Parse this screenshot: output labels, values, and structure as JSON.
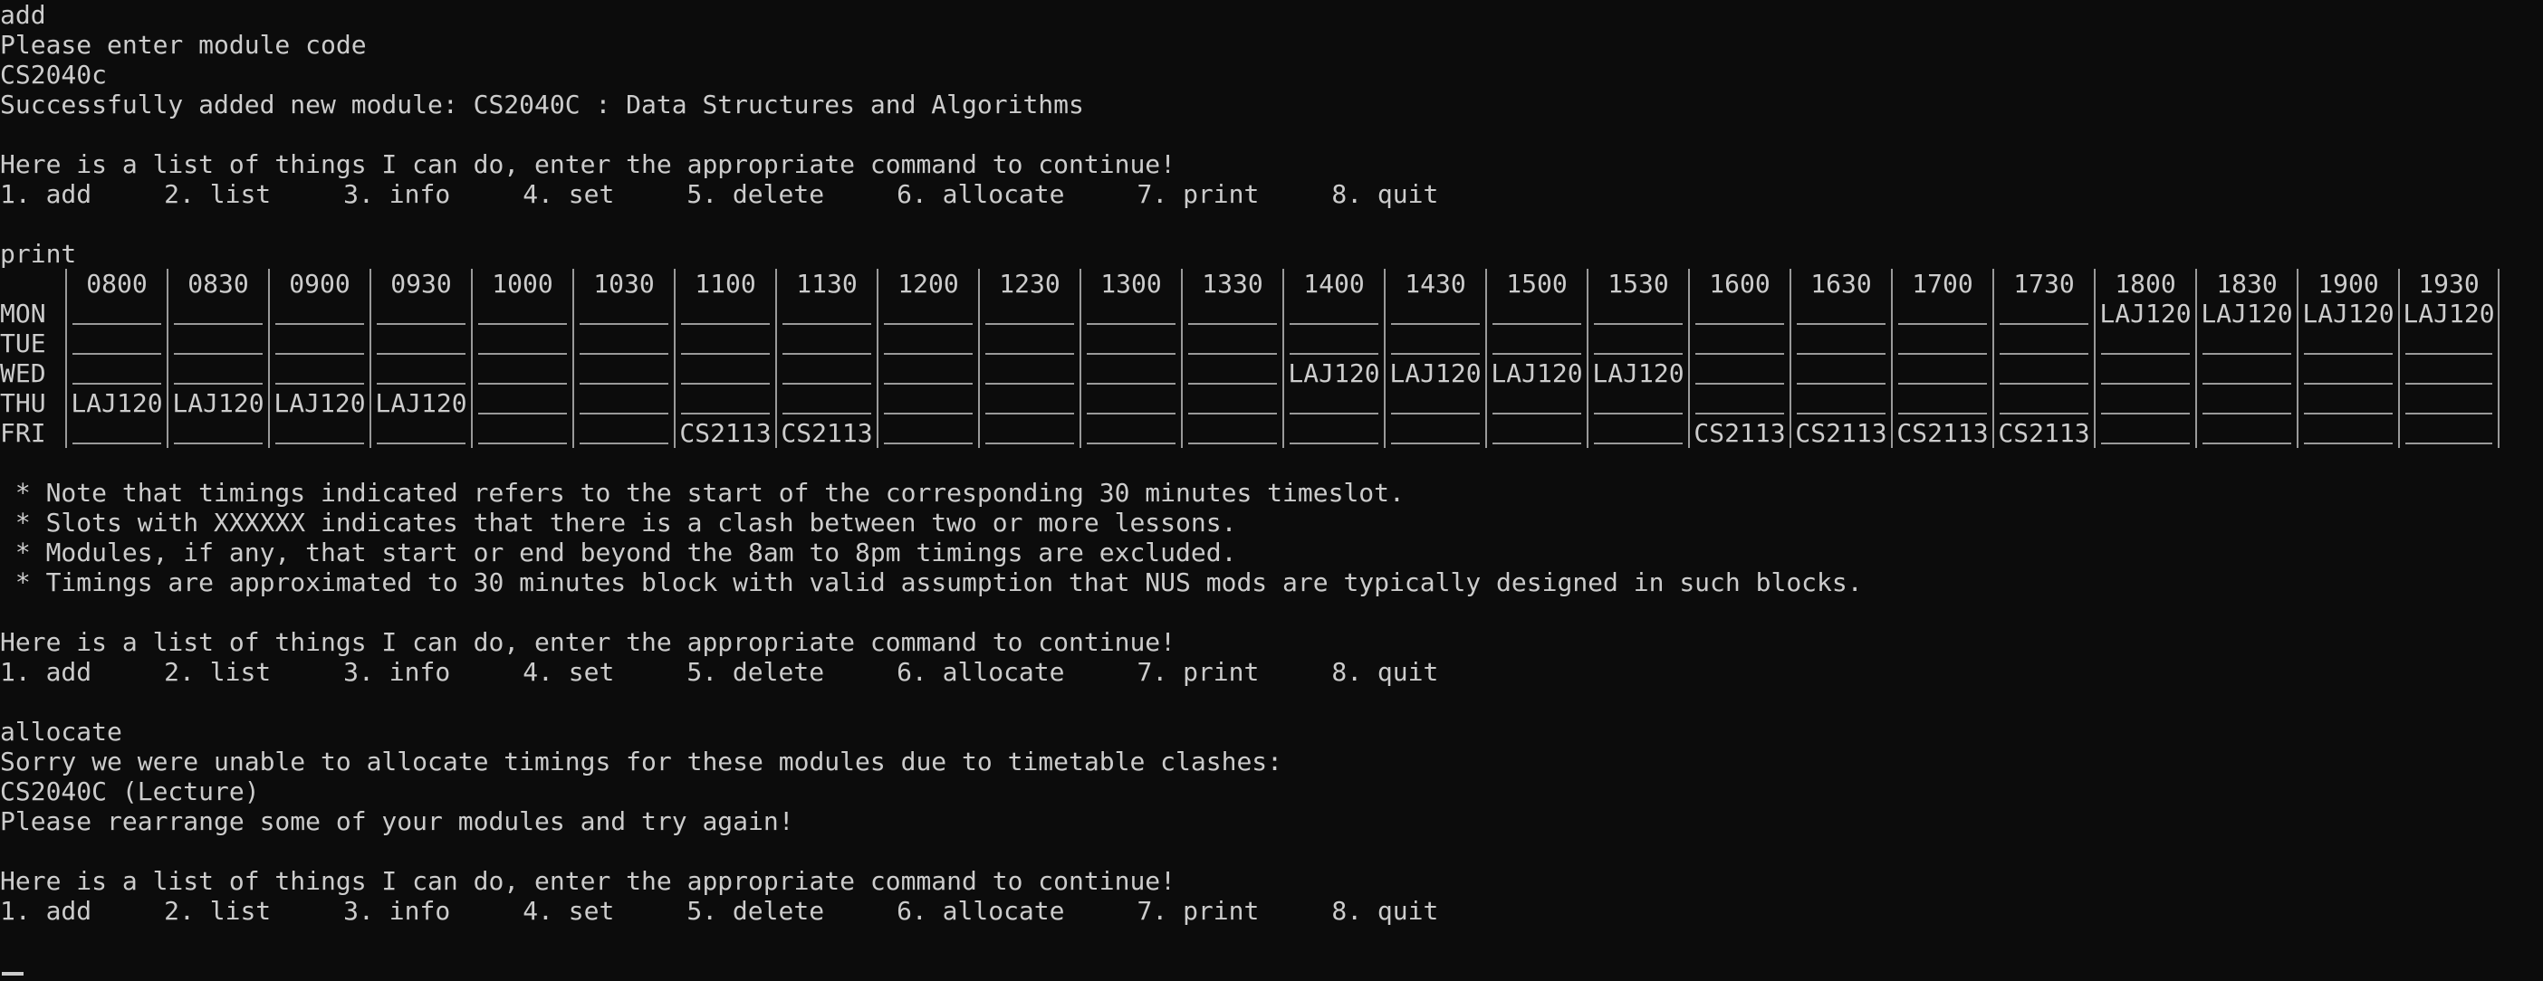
{
  "session_top": {
    "cmd_add": "add",
    "prompt_module": "Please enter module code",
    "input_module": "CS2040c",
    "success_msg": "Successfully added new module: CS2040C : Data Structures and Algorithms"
  },
  "menu_intro": "Here is a list of things I can do, enter the appropriate command to continue!",
  "menu_items": [
    "1. add",
    "2. list",
    "3. info",
    "4. set",
    "5. delete",
    "6. allocate",
    "7. print",
    "8. quit"
  ],
  "cmd_print": "print",
  "timetable": {
    "times": [
      "0800",
      "0830",
      "0900",
      "0930",
      "1000",
      "1030",
      "1100",
      "1130",
      "1200",
      "1230",
      "1300",
      "1330",
      "1400",
      "1430",
      "1500",
      "1530",
      "1600",
      "1630",
      "1700",
      "1730",
      "1800",
      "1830",
      "1900",
      "1930"
    ],
    "days": [
      "MON",
      "TUE",
      "WED",
      "THU",
      "FRI"
    ],
    "rows": [
      [
        "",
        "",
        "",
        "",
        "",
        "",
        "",
        "",
        "",
        "",
        "",
        "",
        "",
        "",
        "",
        "",
        "",
        "",
        "",
        "",
        "LAJ120",
        "LAJ120",
        "LAJ120",
        "LAJ120"
      ],
      [
        "",
        "",
        "",
        "",
        "",
        "",
        "",
        "",
        "",
        "",
        "",
        "",
        "",
        "",
        "",
        "",
        "",
        "",
        "",
        "",
        "",
        "",
        "",
        ""
      ],
      [
        "",
        "",
        "",
        "",
        "",
        "",
        "",
        "",
        "",
        "",
        "",
        "",
        "LAJ120",
        "LAJ120",
        "LAJ120",
        "LAJ120",
        "",
        "",
        "",
        "",
        "",
        "",
        "",
        ""
      ],
      [
        "LAJ120",
        "LAJ120",
        "LAJ120",
        "LAJ120",
        "",
        "",
        "",
        "",
        "",
        "",
        "",
        "",
        "",
        "",
        "",
        "",
        "",
        "",
        "",
        "",
        "",
        "",
        "",
        ""
      ],
      [
        "",
        "",
        "",
        "",
        "",
        "",
        "CS2113",
        "CS2113",
        "",
        "",
        "",
        "",
        "",
        "",
        "",
        "",
        "CS2113",
        "CS2113",
        "CS2113",
        "CS2113",
        "",
        "",
        "",
        ""
      ]
    ]
  },
  "notes": [
    " * Note that timings indicated refers to the start of the corresponding 30 minutes timeslot.",
    " * Slots with XXXXXX indicates that there is a clash between two or more lessons.",
    " * Modules, if any, that start or end beyond the 8am to 8pm timings are excluded.",
    " * Timings are approximated to 30 minutes block with valid assumption that NUS mods are typically designed in such blocks."
  ],
  "allocate_section": {
    "cmd_allocate": "allocate",
    "sorry_msg": "Sorry we were unable to allocate timings for these modules due to timetable clashes:",
    "clash_item": "CS2040C (Lecture)",
    "retry_msg": "Please rearrange some of your modules and try again!"
  }
}
